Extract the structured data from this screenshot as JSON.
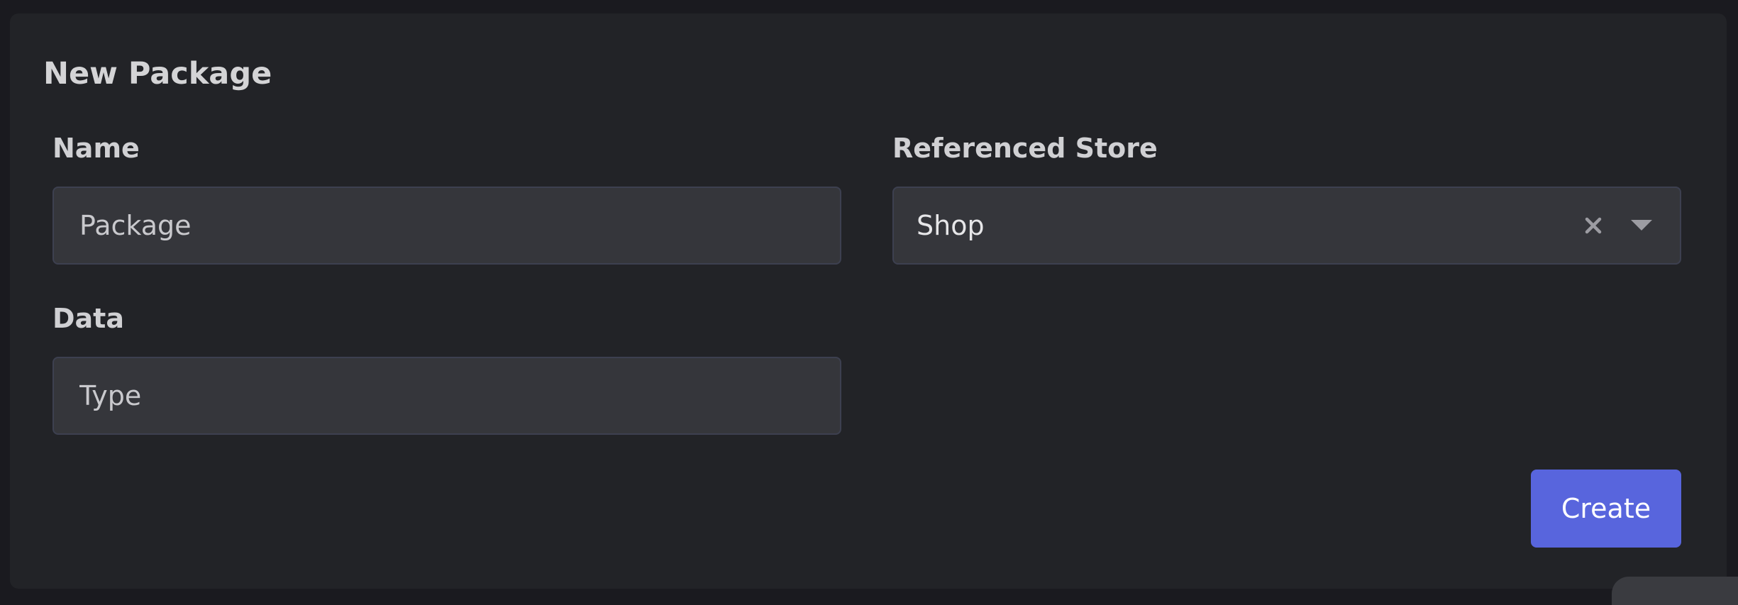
{
  "form": {
    "title": "New Package",
    "name": {
      "label": "Name",
      "placeholder": "Package",
      "value": ""
    },
    "data": {
      "label": "Data",
      "placeholder": "Type",
      "value": ""
    },
    "referenced_store": {
      "label": "Referenced Store",
      "selected": "Shop",
      "clear_icon": "close-icon",
      "dropdown_icon": "chevron-down-icon"
    },
    "create_label": "Create"
  },
  "colors": {
    "accent": "#5865dd",
    "card_background": "#222327",
    "page_background": "#1a1a1f",
    "field_background": "#35363b"
  }
}
